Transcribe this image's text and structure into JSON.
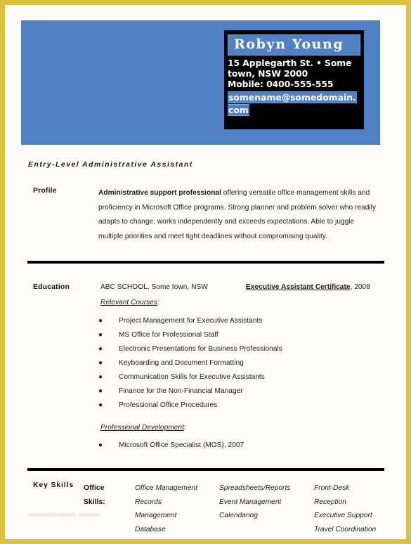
{
  "colors": {
    "page_border_gold": "#ddc042",
    "header_blue": "#4f81c4",
    "contact_box_black": "#000000",
    "rule_black": "#000000",
    "text": "#1c1c1c"
  },
  "header": {
    "name": "Robyn Young",
    "address_line1": "15 Applegarth St. • Some",
    "address_line2": "town, NSW 2000",
    "mobile": "Mobile: 0400-555-555",
    "email": "somename@somedomain.com"
  },
  "job_title": "Entry-Level Administrative Assistant",
  "profile": {
    "label": "Profile",
    "lead": "Administrative support professional",
    "body": " offering versatile office management skills and proficiency in Microsoft Office programs. Strong planner and problem solver who readily adapts to change, works independently and exceeds expectations. Able to juggle multiple priorities and meet tight deadlines without compromising quality."
  },
  "education": {
    "label": "Education",
    "school": "ABC SCHOOL, Some town, NSW",
    "certificate": "Executive Assistant Certificate",
    "certificate_year": ", 2008",
    "relevant_courses_heading": "Relevant Courses",
    "relevant_courses_colon": ":",
    "courses": [
      "Project Management for Executive Assistants",
      "MS Office for Professional Staff",
      "Electronic Presentations for Business Professionals",
      "Keyboarding and Document Formatting",
      "Communication Skills for Executive Assistants",
      "Finance for the Non-Financial Manager",
      "Professional Office Procedures"
    ],
    "professional_development_heading": "Professional Development",
    "professional_development_colon": ":",
    "development": [
      "Microsoft Office Specialist (MOS), 2007"
    ]
  },
  "key_skills": {
    "label": "Key Skills",
    "office_skills_label": "Office Skills:",
    "column1": [
      "Office Management",
      "Records",
      "Management",
      "Database"
    ],
    "column2": [
      "Spreadsheets/Reports",
      "Event Management",
      "Calendaring"
    ],
    "column3": [
      "Front-Desk",
      "Reception",
      "Executive Support",
      "Travel Coordination"
    ]
  },
  "bullet_glyph": "●",
  "watermark": "resumetemplate sample"
}
